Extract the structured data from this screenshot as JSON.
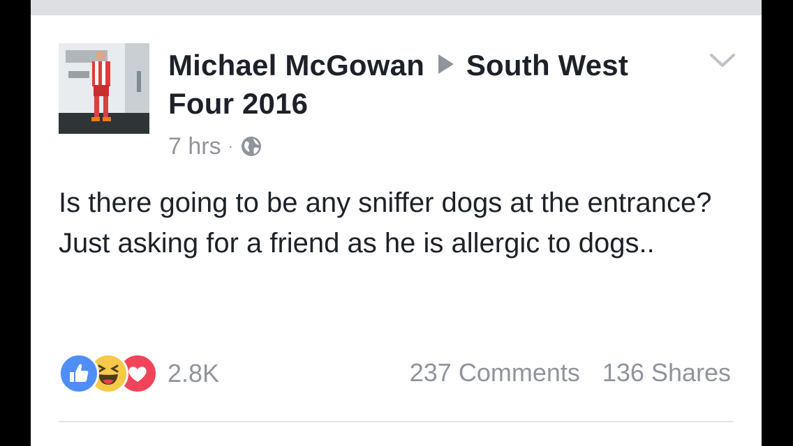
{
  "post": {
    "author": "Michael McGowan",
    "target_group": "South West Four 2016",
    "timestamp": "7 hrs",
    "separator": "·",
    "privacy_icon": "globe-icon",
    "text": "Is there going to be any sniffer dogs at the entrance? Just asking for a friend as he is allergic to dogs..",
    "reactions": {
      "icons": [
        "like-icon",
        "haha-icon",
        "love-icon"
      ],
      "count": "2.8K"
    },
    "comments_label": "237 Comments",
    "shares_label": "136 Shares"
  },
  "colors": {
    "like": "#4f8ef7",
    "haha": "#f7c948",
    "love": "#f0445b",
    "muted_text": "#90949c",
    "body_text": "#1d2129"
  }
}
